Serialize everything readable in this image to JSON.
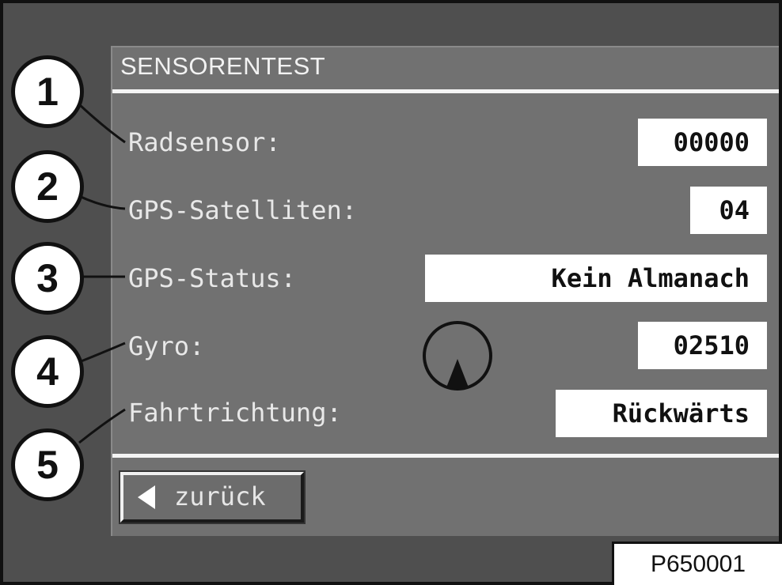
{
  "screen": {
    "title": "SENSORENTEST"
  },
  "rows": [
    {
      "label": "Radsensor:",
      "value": "00000"
    },
    {
      "label": "GPS-Satelliten:",
      "value": "04"
    },
    {
      "label": "GPS-Status:",
      "value": "Kein Almanach"
    },
    {
      "label": "Gyro:",
      "value": "02510"
    },
    {
      "label": "Fahrtrichtung:",
      "value": "Rückwärts"
    }
  ],
  "back_button": {
    "label": "zurück",
    "icon": "arrow-left-icon"
  },
  "gyro_gauge": {
    "icon": "direction-indicator-icon"
  },
  "callouts": [
    "1",
    "2",
    "3",
    "4",
    "5"
  ],
  "figure_id": "P650001",
  "colors": {
    "frame": "#4f4f4f",
    "screen": "#717171",
    "text": "#e8e8e8",
    "value_box": "#ffffff"
  }
}
